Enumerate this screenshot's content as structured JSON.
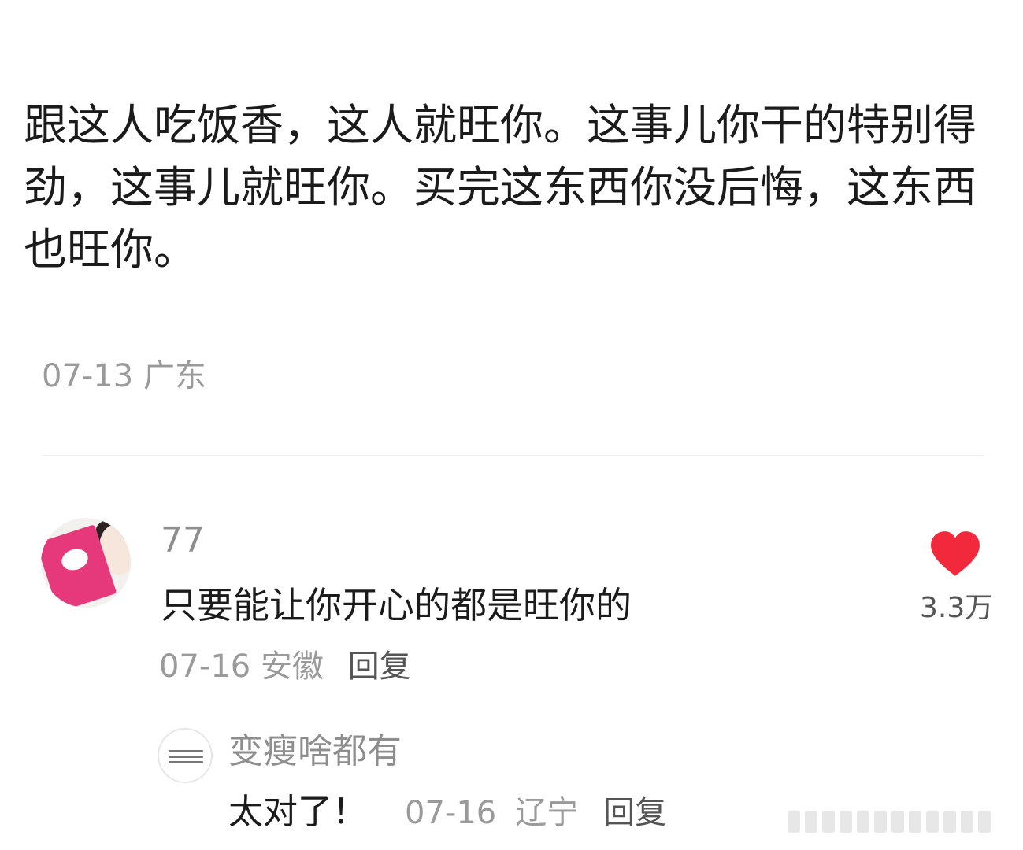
{
  "post": {
    "body": "跟这人吃饭香，这人就旺你。这事儿你干的特别得劲，这事儿就旺你。买完这东西你没后悔，这东西也旺你。",
    "date": "07-13",
    "location": "广东"
  },
  "comment": {
    "username": "77",
    "text": "只要能让你开心的都是旺你的",
    "date": "07-16",
    "location": "安徽",
    "reply_label": "回复",
    "like_count": "3.3万",
    "like_color": "#f2283c"
  },
  "reply": {
    "username": "变瘦啥都有",
    "text": "太对了！",
    "date": "07-16",
    "location": "辽宁",
    "reply_label": "回复"
  }
}
